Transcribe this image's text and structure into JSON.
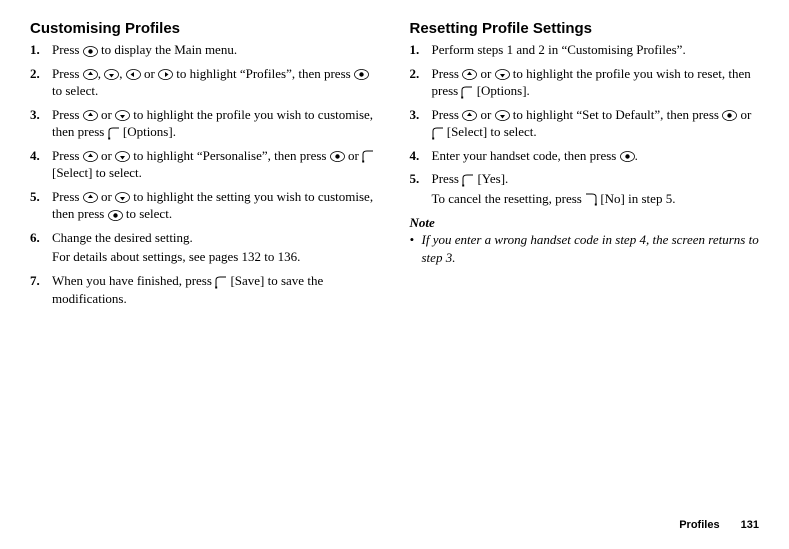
{
  "left": {
    "heading": "Customising Profiles",
    "items": [
      {
        "num": "1.",
        "parts": [
          "Press ",
          {
            "icon": "nav-center"
          },
          " to display the Main menu."
        ]
      },
      {
        "num": "2.",
        "parts": [
          "Press ",
          {
            "icon": "nav-up"
          },
          ", ",
          {
            "icon": "nav-down"
          },
          ", ",
          {
            "icon": "nav-left"
          },
          " or ",
          {
            "icon": "nav-right"
          },
          " to highlight “Profiles”, then press ",
          {
            "icon": "nav-center"
          },
          " to select."
        ]
      },
      {
        "num": "3.",
        "parts": [
          "Press ",
          {
            "icon": "nav-up"
          },
          " or ",
          {
            "icon": "nav-down"
          },
          " to highlight the profile you wish to customise, then press ",
          {
            "icon": "soft-left"
          },
          " [Options]."
        ]
      },
      {
        "num": "4.",
        "parts": [
          "Press ",
          {
            "icon": "nav-up"
          },
          " or ",
          {
            "icon": "nav-down"
          },
          " to highlight “Personalise”, then press ",
          {
            "icon": "nav-center"
          },
          " or ",
          {
            "icon": "soft-left"
          },
          " [Select] to select."
        ]
      },
      {
        "num": "5.",
        "parts": [
          "Press ",
          {
            "icon": "nav-up"
          },
          " or ",
          {
            "icon": "nav-down"
          },
          " to highlight the setting you wish to customise, then press ",
          {
            "icon": "nav-center"
          },
          " to select."
        ]
      },
      {
        "num": "6.",
        "parts": [
          "Change the desired setting."
        ],
        "sub": "For details about settings, see pages 132 to 136."
      },
      {
        "num": "7.",
        "parts": [
          "When you have finished, press ",
          {
            "icon": "soft-left"
          },
          " [Save] to save the modifications."
        ]
      }
    ]
  },
  "right": {
    "heading": "Resetting Profile Settings",
    "items": [
      {
        "num": "1.",
        "parts": [
          "Perform steps 1 and 2 in “Customising Profiles”."
        ]
      },
      {
        "num": "2.",
        "parts": [
          "Press ",
          {
            "icon": "nav-up"
          },
          " or ",
          {
            "icon": "nav-down"
          },
          " to highlight the profile you wish to reset, then press ",
          {
            "icon": "soft-left"
          },
          " [Options]."
        ]
      },
      {
        "num": "3.",
        "parts": [
          "Press ",
          {
            "icon": "nav-up"
          },
          " or ",
          {
            "icon": "nav-down"
          },
          " to highlight “Set to Default”, then press ",
          {
            "icon": "nav-center"
          },
          " or ",
          {
            "icon": "soft-left"
          },
          " [Select] to select."
        ]
      },
      {
        "num": "4.",
        "parts": [
          "Enter your handset code, then press ",
          {
            "icon": "nav-center"
          },
          "."
        ]
      },
      {
        "num": "5.",
        "parts": [
          "Press ",
          {
            "icon": "soft-left"
          },
          " [Yes]."
        ],
        "sub_parts": [
          "To cancel the resetting, press ",
          {
            "icon": "soft-right"
          },
          " [No] in step 5."
        ]
      }
    ],
    "note_heading": "Note",
    "note_body": "If you enter a wrong handset code in step 4, the screen returns to step 3."
  },
  "footer": {
    "section": "Profiles",
    "page": "131"
  }
}
